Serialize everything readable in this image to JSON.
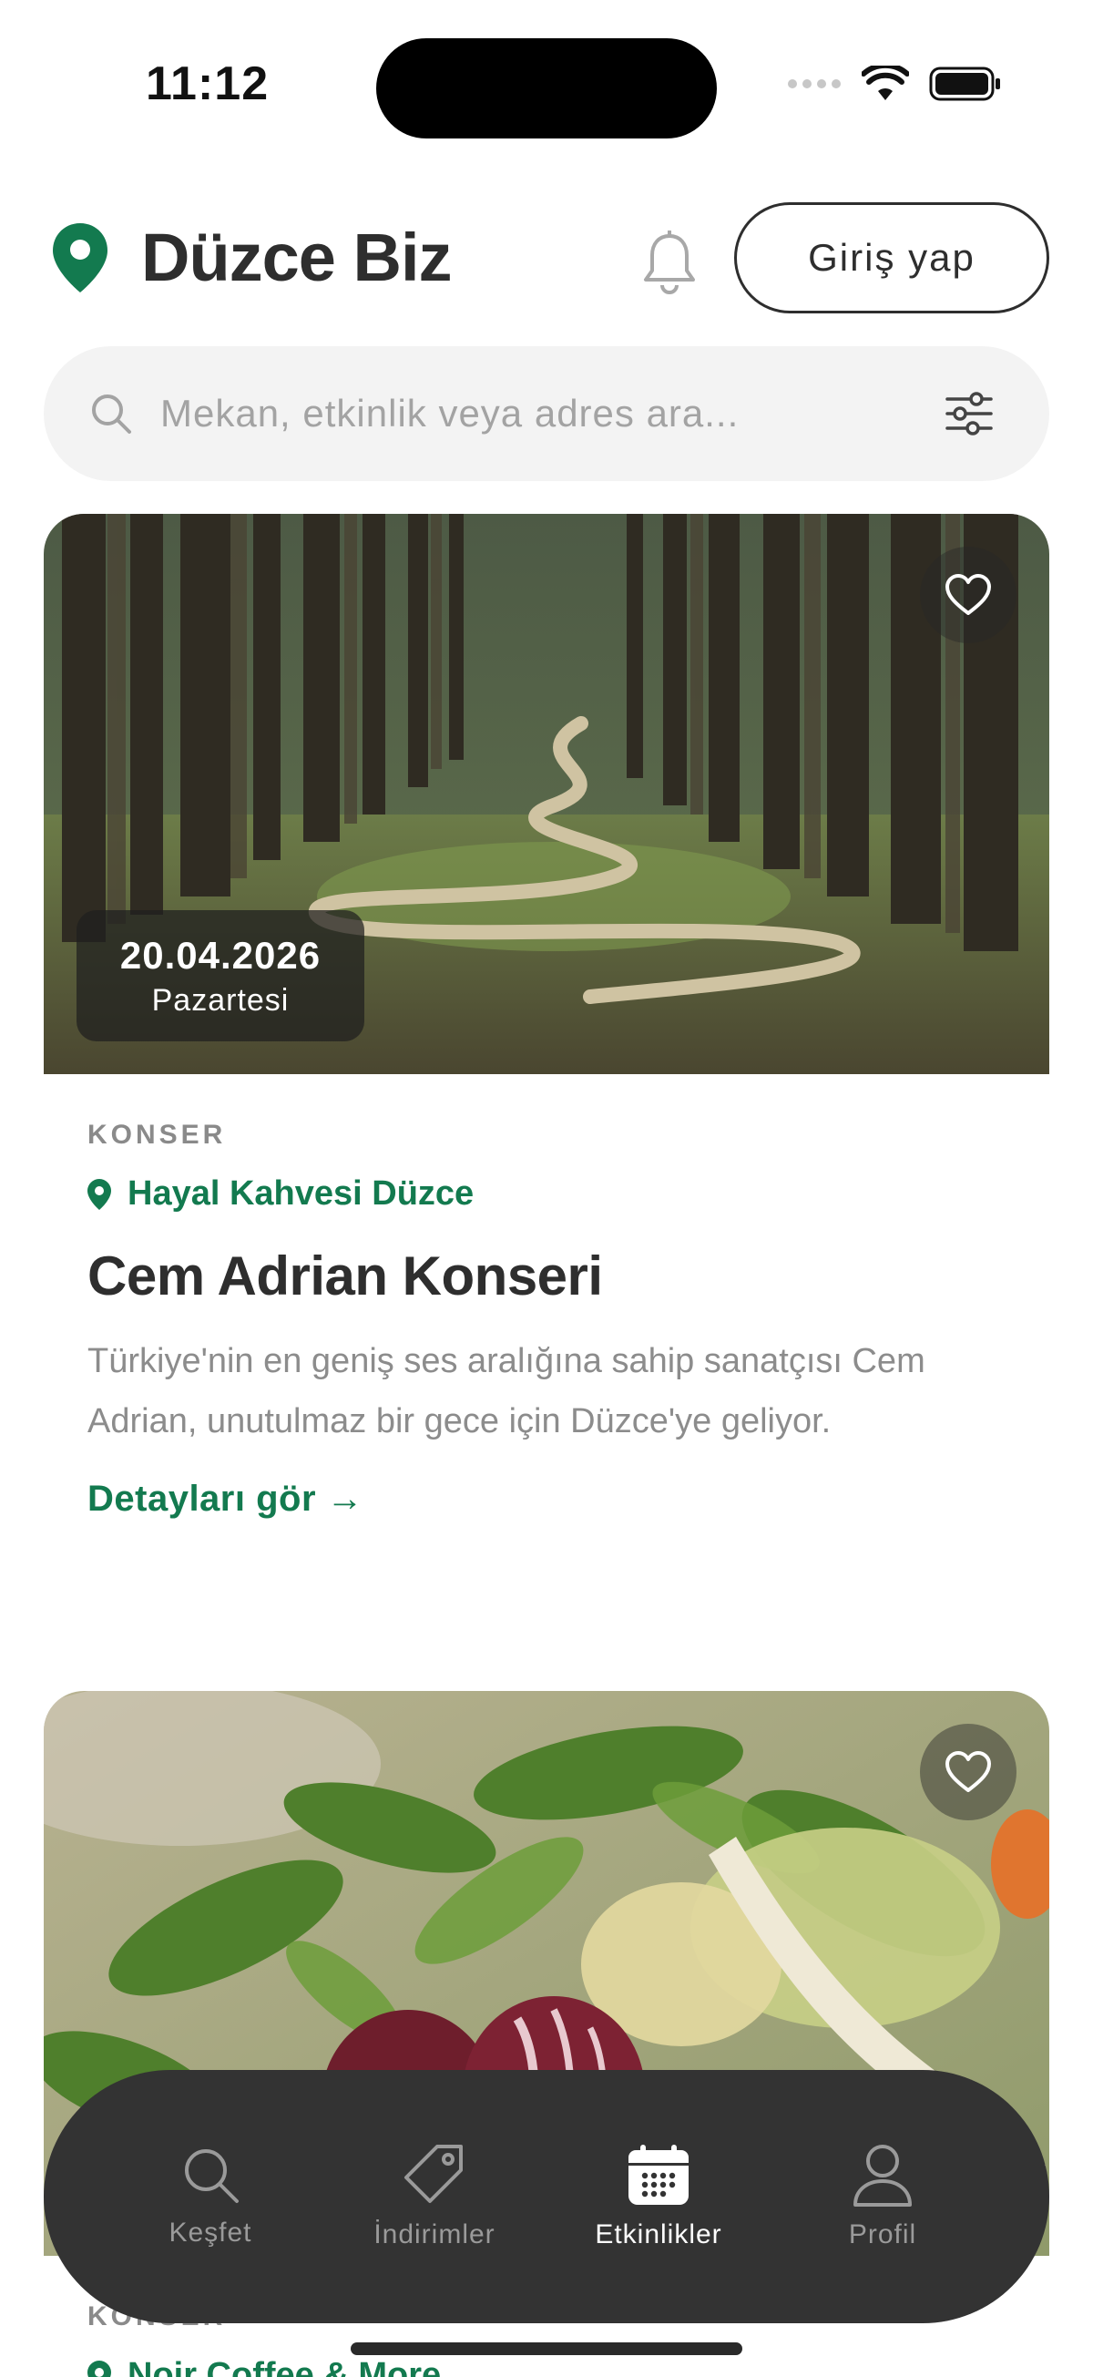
{
  "status_bar": {
    "time": "11:12"
  },
  "header": {
    "title": "Düzce Biz",
    "login_label": "Giriş yap",
    "accent": "#137a4f"
  },
  "search": {
    "placeholder": "Mekan, etkinlik veya adres ara..."
  },
  "events": [
    {
      "date": "20.04.2026",
      "day": "Pazartesi",
      "category": "KONSER",
      "venue": "Hayal Kahvesi Düzce",
      "title": "Cem Adrian Konseri",
      "description": "Türkiye'nin en geniş ses aralığına sahip sanatçısı Cem Adrian, unutulmaz bir gece için Düzce'ye geliyor.",
      "link": "Detayları gör →"
    },
    {
      "category": "KONSER",
      "venue": "Noir Coffee & More"
    }
  ],
  "nav": {
    "items": [
      {
        "label": "Keşfet",
        "icon": "search-icon"
      },
      {
        "label": "İndirimler",
        "icon": "tag-icon"
      },
      {
        "label": "Etkinlikler",
        "icon": "calendar-icon",
        "active": true
      },
      {
        "label": "Profil",
        "icon": "user-icon"
      }
    ]
  }
}
